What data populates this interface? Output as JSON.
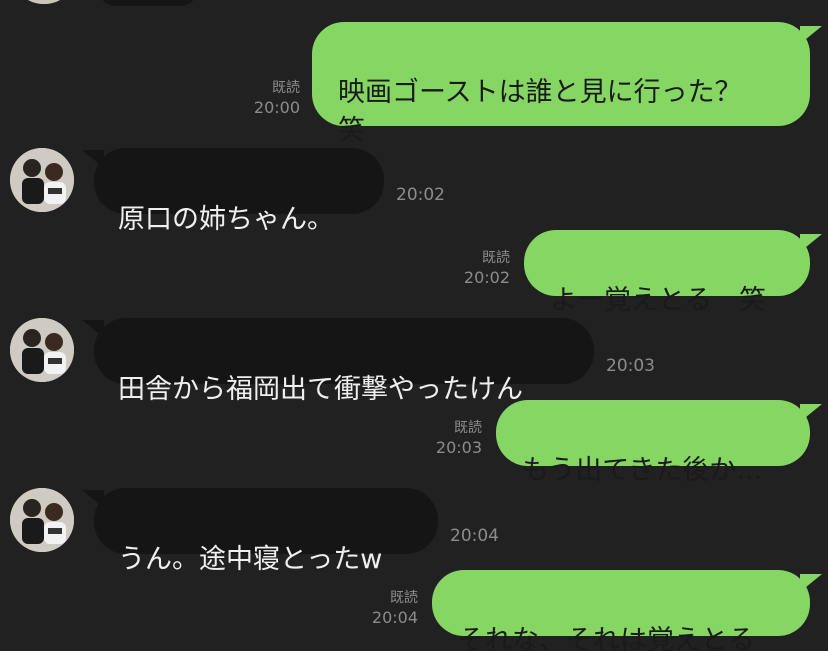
{
  "messages": [
    {
      "side": "out",
      "text": "映画ゴーストは誰と見に行った？\n笑",
      "read": "既読",
      "time": "20:00"
    },
    {
      "side": "in",
      "text": "原口の姉ちゃん。",
      "time": "20:02"
    },
    {
      "side": "out",
      "text": "よー覚えとる　笑",
      "read": "既読",
      "time": "20:02"
    },
    {
      "side": "in",
      "text": "田舎から福岡出て衝撃やったけん",
      "time": "20:03"
    },
    {
      "side": "out",
      "text": "もう出てきた後か...",
      "read": "既読",
      "time": "20:03"
    },
    {
      "side": "in",
      "text": "うん。途中寝とったw",
      "time": "20:04"
    },
    {
      "side": "out",
      "text": "それな、それは覚えとる",
      "read": "既読",
      "time": "20:04"
    }
  ],
  "colors": {
    "background": "#212121",
    "outgoing_bubble": "#86d664",
    "incoming_bubble": "#151515",
    "meta_text": "#8c8c8c"
  },
  "icons": {
    "avatar": "contact-avatar-photo"
  }
}
